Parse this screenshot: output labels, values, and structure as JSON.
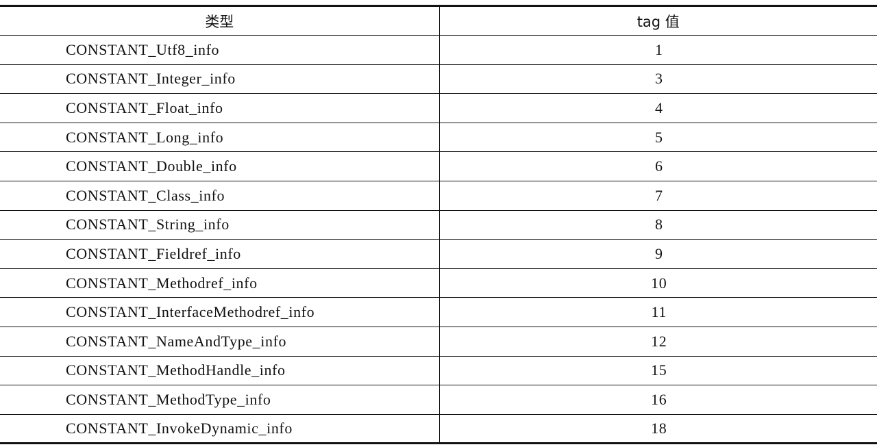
{
  "table": {
    "headers": {
      "type": "类型",
      "tag": "tag 值"
    },
    "rows": [
      {
        "type": "CONSTANT_Utf8_info",
        "tag": "1"
      },
      {
        "type": "CONSTANT_Integer_info",
        "tag": "3"
      },
      {
        "type": "CONSTANT_Float_info",
        "tag": "4"
      },
      {
        "type": "CONSTANT_Long_info",
        "tag": "5"
      },
      {
        "type": "CONSTANT_Double_info",
        "tag": "6"
      },
      {
        "type": "CONSTANT_Class_info",
        "tag": "7"
      },
      {
        "type": "CONSTANT_String_info",
        "tag": "8"
      },
      {
        "type": "CONSTANT_Fieldref_info",
        "tag": "9"
      },
      {
        "type": "CONSTANT_Methodref_info",
        "tag": "10"
      },
      {
        "type": "CONSTANT_InterfaceMethodref_info",
        "tag": "11"
      },
      {
        "type": "CONSTANT_NameAndType_info",
        "tag": "12"
      },
      {
        "type": "CONSTANT_MethodHandle_info",
        "tag": "15"
      },
      {
        "type": "CONSTANT_MethodType_info",
        "tag": "16"
      },
      {
        "type": "CONSTANT_InvokeDynamic_info",
        "tag": "18"
      }
    ]
  }
}
